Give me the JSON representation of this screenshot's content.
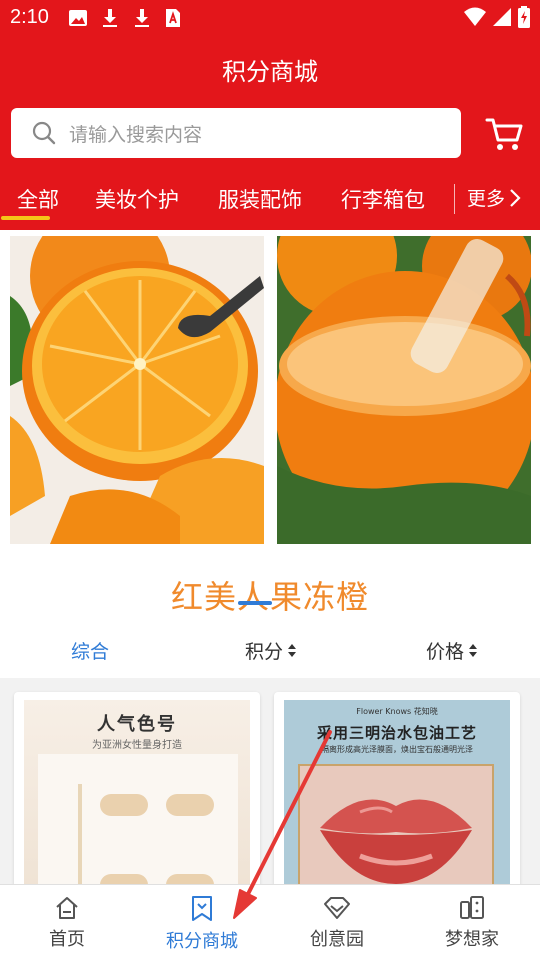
{
  "status_bar": {
    "time": "2:10"
  },
  "header": {
    "title": "积分商城"
  },
  "search": {
    "placeholder": "请输入搜索内容"
  },
  "categories": {
    "items": [
      {
        "label": "全部",
        "active": true
      },
      {
        "label": "美妆个护",
        "active": false
      },
      {
        "label": "服装配饰",
        "active": false
      },
      {
        "label": "行李箱包",
        "active": false
      }
    ],
    "more_label": "更多"
  },
  "banner": {
    "title": "红美人果冻橙"
  },
  "sort": {
    "items": [
      {
        "label": "综合",
        "active": true
      },
      {
        "label": "积分",
        "active": false
      },
      {
        "label": "价格",
        "active": false
      }
    ]
  },
  "products": [
    {
      "headline": "人气色号",
      "subline": "为亚洲女性量身打造"
    },
    {
      "brand": "Flower Knows 花知晓",
      "headline": "采用三明治水包油工艺",
      "subline": "隔离形成高光泽膜面，焕出宝石般通明光泽"
    }
  ],
  "tabbar": {
    "items": [
      {
        "label": "首页",
        "icon": "home-icon",
        "active": false
      },
      {
        "label": "积分商城",
        "icon": "bookmark-icon",
        "active": true
      },
      {
        "label": "创意园",
        "icon": "diamond-icon",
        "active": false
      },
      {
        "label": "梦想家",
        "icon": "phone-icon",
        "active": false
      }
    ]
  },
  "colors": {
    "brand_red": "#e3161b",
    "accent_blue": "#2f7bd6",
    "tab_underline": "#f5c518",
    "banner_title": "#f08a2c"
  }
}
